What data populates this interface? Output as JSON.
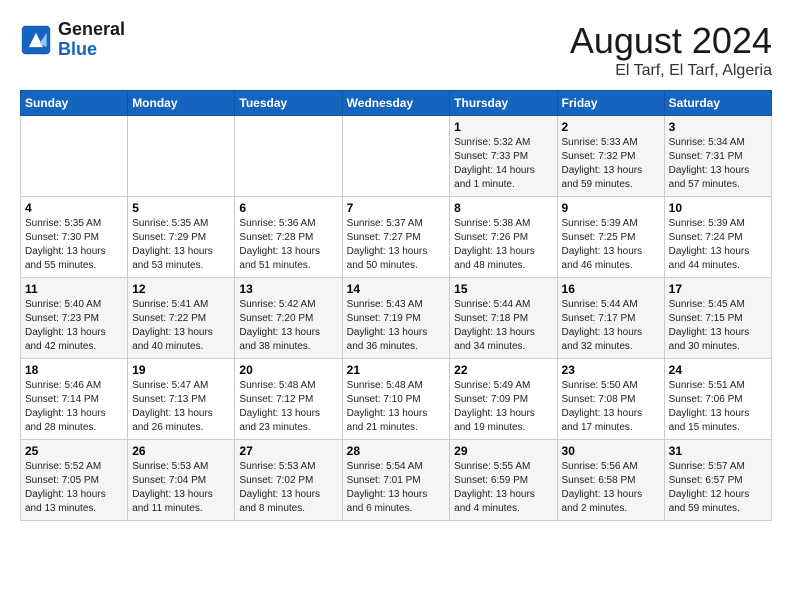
{
  "logo": {
    "line1": "General",
    "line2": "Blue"
  },
  "title": "August 2024",
  "subtitle": "El Tarf, El Tarf, Algeria",
  "weekdays": [
    "Sunday",
    "Monday",
    "Tuesday",
    "Wednesday",
    "Thursday",
    "Friday",
    "Saturday"
  ],
  "weeks": [
    [
      {
        "day": "",
        "info": ""
      },
      {
        "day": "",
        "info": ""
      },
      {
        "day": "",
        "info": ""
      },
      {
        "day": "",
        "info": ""
      },
      {
        "day": "1",
        "info": "Sunrise: 5:32 AM\nSunset: 7:33 PM\nDaylight: 14 hours\nand 1 minute."
      },
      {
        "day": "2",
        "info": "Sunrise: 5:33 AM\nSunset: 7:32 PM\nDaylight: 13 hours\nand 59 minutes."
      },
      {
        "day": "3",
        "info": "Sunrise: 5:34 AM\nSunset: 7:31 PM\nDaylight: 13 hours\nand 57 minutes."
      }
    ],
    [
      {
        "day": "4",
        "info": "Sunrise: 5:35 AM\nSunset: 7:30 PM\nDaylight: 13 hours\nand 55 minutes."
      },
      {
        "day": "5",
        "info": "Sunrise: 5:35 AM\nSunset: 7:29 PM\nDaylight: 13 hours\nand 53 minutes."
      },
      {
        "day": "6",
        "info": "Sunrise: 5:36 AM\nSunset: 7:28 PM\nDaylight: 13 hours\nand 51 minutes."
      },
      {
        "day": "7",
        "info": "Sunrise: 5:37 AM\nSunset: 7:27 PM\nDaylight: 13 hours\nand 50 minutes."
      },
      {
        "day": "8",
        "info": "Sunrise: 5:38 AM\nSunset: 7:26 PM\nDaylight: 13 hours\nand 48 minutes."
      },
      {
        "day": "9",
        "info": "Sunrise: 5:39 AM\nSunset: 7:25 PM\nDaylight: 13 hours\nand 46 minutes."
      },
      {
        "day": "10",
        "info": "Sunrise: 5:39 AM\nSunset: 7:24 PM\nDaylight: 13 hours\nand 44 minutes."
      }
    ],
    [
      {
        "day": "11",
        "info": "Sunrise: 5:40 AM\nSunset: 7:23 PM\nDaylight: 13 hours\nand 42 minutes."
      },
      {
        "day": "12",
        "info": "Sunrise: 5:41 AM\nSunset: 7:22 PM\nDaylight: 13 hours\nand 40 minutes."
      },
      {
        "day": "13",
        "info": "Sunrise: 5:42 AM\nSunset: 7:20 PM\nDaylight: 13 hours\nand 38 minutes."
      },
      {
        "day": "14",
        "info": "Sunrise: 5:43 AM\nSunset: 7:19 PM\nDaylight: 13 hours\nand 36 minutes."
      },
      {
        "day": "15",
        "info": "Sunrise: 5:44 AM\nSunset: 7:18 PM\nDaylight: 13 hours\nand 34 minutes."
      },
      {
        "day": "16",
        "info": "Sunrise: 5:44 AM\nSunset: 7:17 PM\nDaylight: 13 hours\nand 32 minutes."
      },
      {
        "day": "17",
        "info": "Sunrise: 5:45 AM\nSunset: 7:15 PM\nDaylight: 13 hours\nand 30 minutes."
      }
    ],
    [
      {
        "day": "18",
        "info": "Sunrise: 5:46 AM\nSunset: 7:14 PM\nDaylight: 13 hours\nand 28 minutes."
      },
      {
        "day": "19",
        "info": "Sunrise: 5:47 AM\nSunset: 7:13 PM\nDaylight: 13 hours\nand 26 minutes."
      },
      {
        "day": "20",
        "info": "Sunrise: 5:48 AM\nSunset: 7:12 PM\nDaylight: 13 hours\nand 23 minutes."
      },
      {
        "day": "21",
        "info": "Sunrise: 5:48 AM\nSunset: 7:10 PM\nDaylight: 13 hours\nand 21 minutes."
      },
      {
        "day": "22",
        "info": "Sunrise: 5:49 AM\nSunset: 7:09 PM\nDaylight: 13 hours\nand 19 minutes."
      },
      {
        "day": "23",
        "info": "Sunrise: 5:50 AM\nSunset: 7:08 PM\nDaylight: 13 hours\nand 17 minutes."
      },
      {
        "day": "24",
        "info": "Sunrise: 5:51 AM\nSunset: 7:06 PM\nDaylight: 13 hours\nand 15 minutes."
      }
    ],
    [
      {
        "day": "25",
        "info": "Sunrise: 5:52 AM\nSunset: 7:05 PM\nDaylight: 13 hours\nand 13 minutes."
      },
      {
        "day": "26",
        "info": "Sunrise: 5:53 AM\nSunset: 7:04 PM\nDaylight: 13 hours\nand 11 minutes."
      },
      {
        "day": "27",
        "info": "Sunrise: 5:53 AM\nSunset: 7:02 PM\nDaylight: 13 hours\nand 8 minutes."
      },
      {
        "day": "28",
        "info": "Sunrise: 5:54 AM\nSunset: 7:01 PM\nDaylight: 13 hours\nand 6 minutes."
      },
      {
        "day": "29",
        "info": "Sunrise: 5:55 AM\nSunset: 6:59 PM\nDaylight: 13 hours\nand 4 minutes."
      },
      {
        "day": "30",
        "info": "Sunrise: 5:56 AM\nSunset: 6:58 PM\nDaylight: 13 hours\nand 2 minutes."
      },
      {
        "day": "31",
        "info": "Sunrise: 5:57 AM\nSunset: 6:57 PM\nDaylight: 12 hours\nand 59 minutes."
      }
    ]
  ]
}
